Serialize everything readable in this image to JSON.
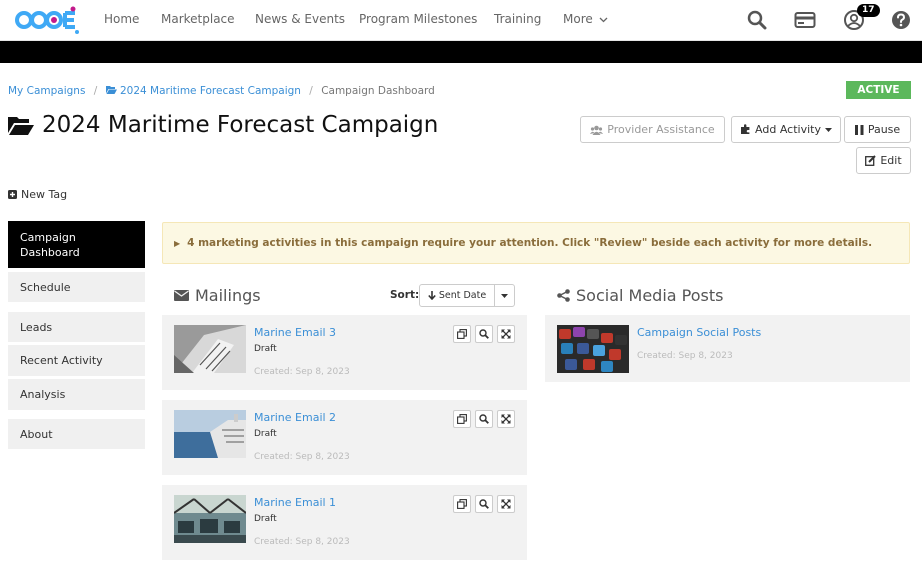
{
  "nav": {
    "links": [
      "Home",
      "Marketplace",
      "News & Events",
      "Program Milestones",
      "Training",
      "More"
    ],
    "notification_count": "17",
    "icons": [
      "search-icon",
      "billing-card-icon",
      "user-account-icon",
      "help-icon"
    ]
  },
  "breadcrumb": [
    "My Campaigns",
    "2024 Maritime Forecast Campaign",
    "Campaign Dashboard"
  ],
  "status": "ACTIVE",
  "page_title": "2024 Maritime Forecast Campaign",
  "buttons": {
    "provider_assistance": "Provider Assistance",
    "add_activity": "Add Activity",
    "pause": "Pause",
    "edit": "Edit"
  },
  "new_tag": "New Tag",
  "sidebar": [
    "Campaign Dashboard",
    "Schedule",
    "Leads",
    "Recent Activity",
    "Analysis",
    "About"
  ],
  "alert": "4 marketing activities in this campaign require your attention. Click \"Review\" beside each activity for more details.",
  "mailings": {
    "title": "Mailings",
    "sort_label": "Sort:",
    "sort_value": "Sent Date",
    "items": [
      {
        "title": "Marine Email 3",
        "status": "Draft",
        "created": "Created: Sep 8, 2023"
      },
      {
        "title": "Marine Email 2",
        "status": "Draft",
        "created": "Created: Sep 8, 2023"
      },
      {
        "title": "Marine Email 1",
        "status": "Draft",
        "created": "Created: Sep 8, 2023"
      }
    ]
  },
  "social": {
    "title": "Social Media Posts",
    "items": [
      {
        "title": "Campaign Social Posts",
        "created": "Created: Sep 8, 2023"
      }
    ]
  },
  "colors": {
    "link": "#3b8fd6",
    "active_status": "#5cb85c",
    "alert_bg": "#fcf8e3",
    "alert_text": "#8a6d3b"
  }
}
